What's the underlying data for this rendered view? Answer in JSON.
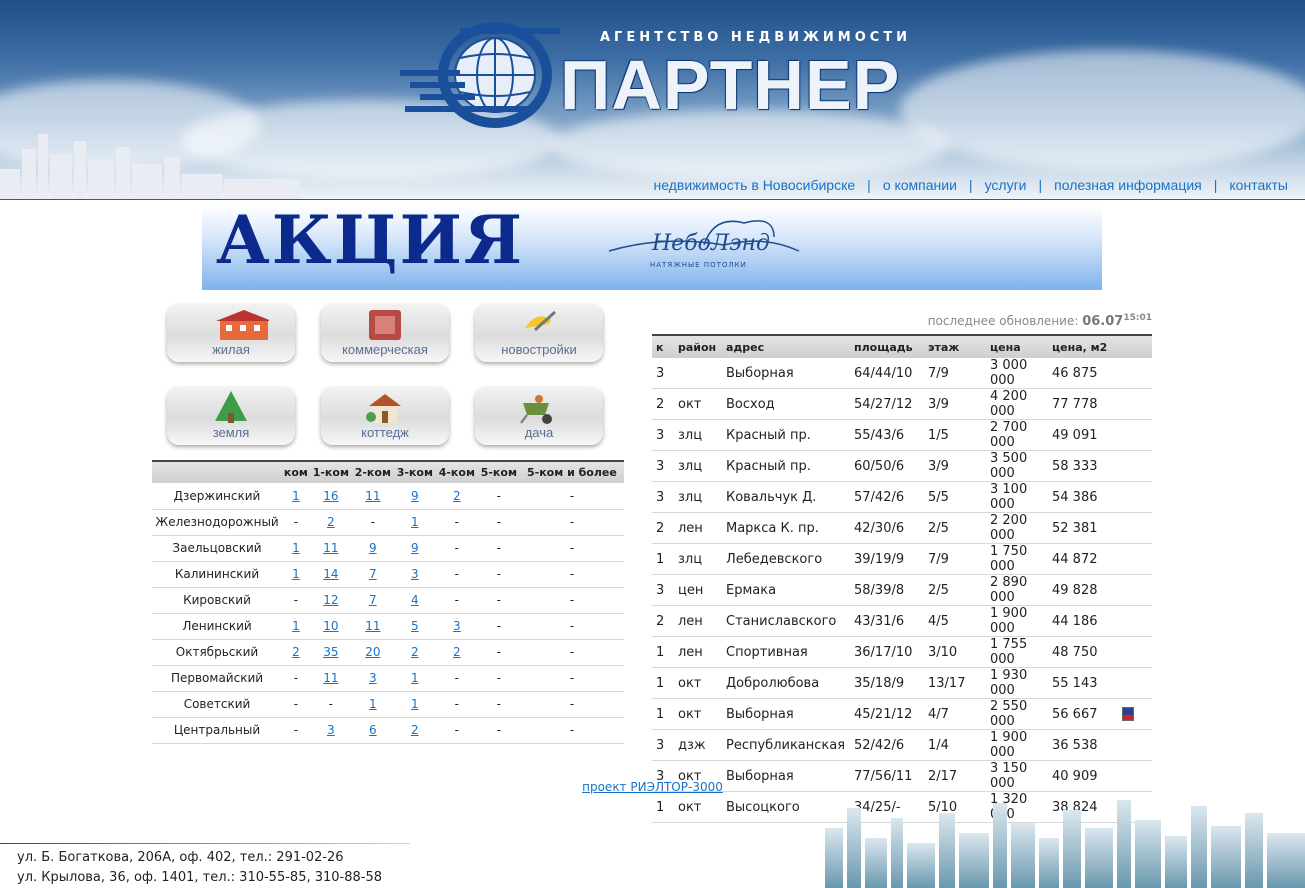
{
  "header": {
    "agency": "АГЕНТСТВО  НЕДВИЖИМОСТИ",
    "brand": "ПАРТНЕР"
  },
  "nav": [
    {
      "label": "недвижимость в Новосибирске"
    },
    {
      "label": "о компании"
    },
    {
      "label": "услуги"
    },
    {
      "label": "полезная информация"
    },
    {
      "label": "контакты"
    }
  ],
  "banner": {
    "title": "АКЦИЯ",
    "brand_name": "НебоЛэнд",
    "brand_sub": "НАТЯЖНЫЕ ПОТОЛКИ"
  },
  "categories": [
    {
      "label": "жилая",
      "icon": "house-icon"
    },
    {
      "label": "коммерческая",
      "icon": "safe-icon"
    },
    {
      "label": "новостройки",
      "icon": "construction-icon"
    },
    {
      "label": "земля",
      "icon": "tree-icon"
    },
    {
      "label": "коттедж",
      "icon": "cottage-icon"
    },
    {
      "label": "дача",
      "icon": "wheelbarrow-icon"
    }
  ],
  "districts": {
    "headers": [
      "",
      "ком",
      "1-ком",
      "2-ком",
      "3-ком",
      "4-ком",
      "5-ком",
      "5-ком и более"
    ],
    "rows": [
      {
        "name": "Дзержинский",
        "cells": [
          "1",
          "16",
          "11",
          "9",
          "2",
          "-",
          "-"
        ]
      },
      {
        "name": "Железнодорожный",
        "cells": [
          "-",
          "2",
          "-",
          "1",
          "-",
          "-",
          "-"
        ]
      },
      {
        "name": "Заельцовский",
        "cells": [
          "1",
          "11",
          "9",
          "9",
          "-",
          "-",
          "-"
        ]
      },
      {
        "name": "Калининский",
        "cells": [
          "1",
          "14",
          "7",
          "3",
          "-",
          "-",
          "-"
        ]
      },
      {
        "name": "Кировский",
        "cells": [
          "-",
          "12",
          "7",
          "4",
          "-",
          "-",
          "-"
        ]
      },
      {
        "name": "Ленинский",
        "cells": [
          "1",
          "10",
          "11",
          "5",
          "3",
          "-",
          "-"
        ]
      },
      {
        "name": "Октябрьский",
        "cells": [
          "2",
          "35",
          "20",
          "2",
          "2",
          "-",
          "-"
        ]
      },
      {
        "name": "Первомайский",
        "cells": [
          "-",
          "11",
          "3",
          "1",
          "-",
          "-",
          "-"
        ]
      },
      {
        "name": "Советский",
        "cells": [
          "-",
          "-",
          "1",
          "1",
          "-",
          "-",
          "-"
        ]
      },
      {
        "name": "Центральный",
        "cells": [
          "-",
          "3",
          "6",
          "2",
          "-",
          "-",
          "-"
        ]
      }
    ]
  },
  "listings": {
    "updated_label": "последнее обновление:",
    "updated_date": "06.07",
    "updated_time": "15:01",
    "headers": [
      "к",
      "район",
      "адрес",
      "площадь",
      "этаж",
      "цена",
      "цена, м2"
    ],
    "rows": [
      [
        "3",
        "",
        "Выборная",
        "64/44/10",
        "7/9",
        "3 000 000",
        "46 875"
      ],
      [
        "2",
        "окт",
        "Восход",
        "54/27/12",
        "3/9",
        "4 200 000",
        "77 778"
      ],
      [
        "3",
        "злц",
        "Красный пр.",
        "55/43/6",
        "1/5",
        "2 700 000",
        "49 091"
      ],
      [
        "3",
        "злц",
        "Красный пр.",
        "60/50/6",
        "3/9",
        "3 500 000",
        "58 333"
      ],
      [
        "3",
        "злц",
        "Ковальчук Д.",
        "57/42/6",
        "5/5",
        "3 100 000",
        "54 386"
      ],
      [
        "2",
        "лен",
        "Маркса К. пр.",
        "42/30/6",
        "2/5",
        "2 200 000",
        "52 381"
      ],
      [
        "1",
        "злц",
        "Лебедевского",
        "39/19/9",
        "7/9",
        "1 750 000",
        "44 872"
      ],
      [
        "3",
        "цен",
        "Ермака",
        "58/39/8",
        "2/5",
        "2 890 000",
        "49 828"
      ],
      [
        "2",
        "лен",
        "Станиславского",
        "43/31/6",
        "4/5",
        "1 900 000",
        "44 186"
      ],
      [
        "1",
        "лен",
        "Спортивная",
        "36/17/10",
        "3/10",
        "1 755 000",
        "48 750"
      ],
      [
        "1",
        "окт",
        "Добролюбова",
        "35/18/9",
        "13/17",
        "1 930 000",
        "55 143"
      ],
      [
        "1",
        "окт",
        "Выборная",
        "45/21/12",
        "4/7",
        "2 550 000",
        "56 667"
      ],
      [
        "3",
        "дзж",
        "Республиканская",
        "52/42/6",
        "1/4",
        "1 900 000",
        "36 538"
      ],
      [
        "3",
        "окт",
        "Выборная",
        "77/56/11",
        "2/17",
        "3 150 000",
        "40 909"
      ],
      [
        "1",
        "окт",
        "Высоцкого",
        "34/25/-",
        "5/10",
        "1 320 000",
        "38 824"
      ]
    ],
    "flag_row": 11
  },
  "project_link": "проект РИЭЛТОР-3000",
  "footer": {
    "addresses": [
      "ул. Б. Богаткова, 206А, оф. 402, тел.: 291-02-26",
      "ул. Крылова, 36, оф. 1401, тел.: 310-55-85, 310-88-58"
    ]
  }
}
